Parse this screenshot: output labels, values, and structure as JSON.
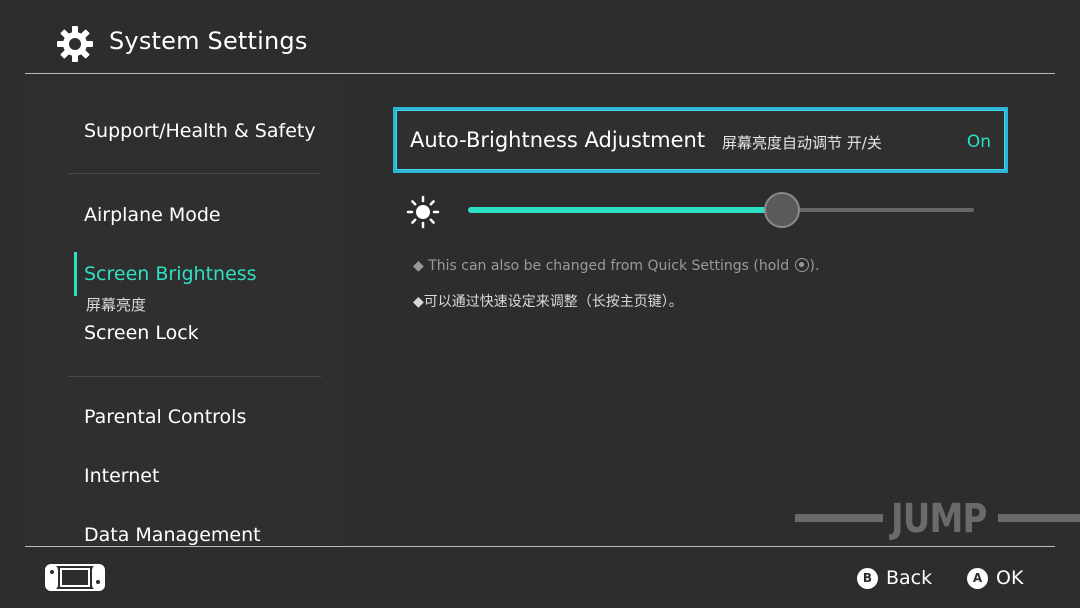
{
  "header": {
    "title": "System Settings",
    "icon": "gear-icon"
  },
  "sidebar": {
    "items": [
      {
        "label": "Support/Health & Safety"
      },
      {
        "label": "Airplane Mode"
      },
      {
        "label": "Screen Brightness",
        "sublabel": "屏幕亮度"
      },
      {
        "label": "Screen Lock"
      },
      {
        "label": "Parental Controls"
      },
      {
        "label": "Internet"
      },
      {
        "label": "Data Management"
      }
    ]
  },
  "main": {
    "auto_brightness": {
      "label": "Auto-Brightness Adjustment",
      "label_cn": "屏幕亮度自动调节 开/关",
      "value": "On"
    },
    "brightness_slider": {
      "level_fraction": 0.62,
      "icon": "sun-icon"
    },
    "note_en_prefix": "◆ This can also be changed from Quick Settings (hold ",
    "note_en_suffix": ").",
    "note_cn": "◆可以通过快速设定来调整（长按主页键）。"
  },
  "watermark": {
    "text": "JUMP"
  },
  "footer": {
    "back": {
      "key": "B",
      "label": "Back"
    },
    "ok": {
      "key": "A",
      "label": "OK"
    }
  },
  "colors": {
    "accent": "#2de0c4",
    "focus_border": "#2eb6d5",
    "background": "#2d2d2d"
  }
}
